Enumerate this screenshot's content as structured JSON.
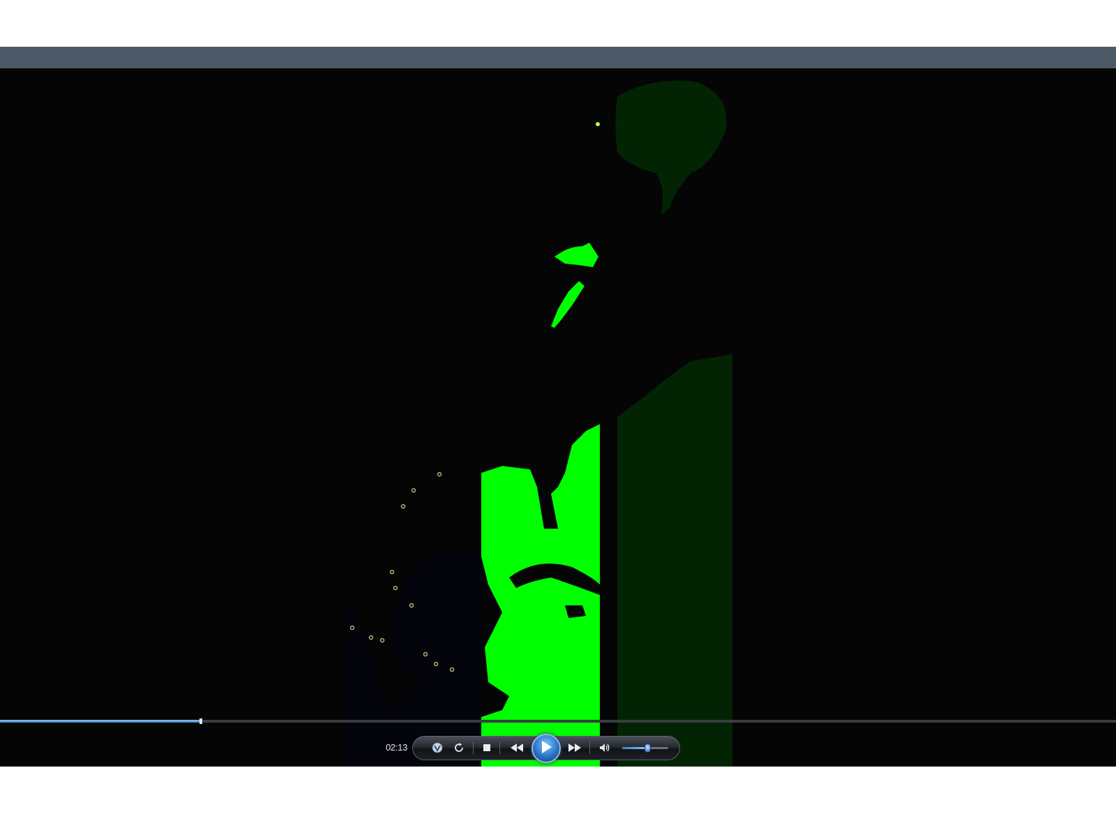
{
  "player": {
    "time": "02:13",
    "seek_progress": 0.18,
    "volume_level": 0.55,
    "accent_color": "#3d7ec8"
  },
  "video": {
    "dominant_colors": [
      "#00ff00",
      "#032403",
      "#050505"
    ]
  },
  "controls": {
    "icons": [
      "shuffle-icon",
      "repeat-icon",
      "stop-icon",
      "previous-icon",
      "play-icon",
      "next-icon",
      "speaker-icon"
    ]
  }
}
